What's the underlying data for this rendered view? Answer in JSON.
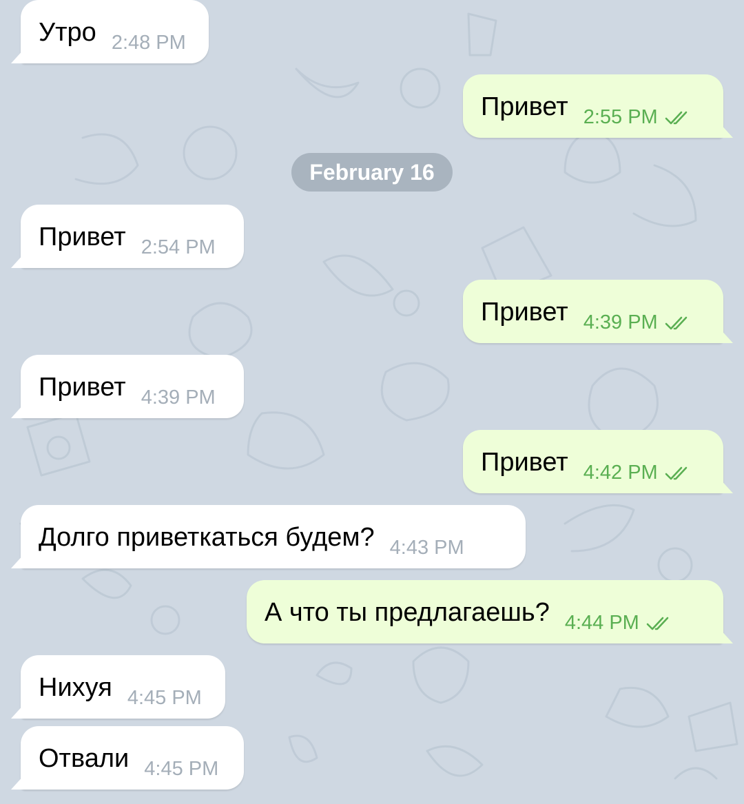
{
  "colors": {
    "background": "#cfd8e2",
    "incoming_bubble": "#ffffff",
    "outgoing_bubble": "#eefed8",
    "outgoing_time": "#5aaf52",
    "incoming_time": "#a4aeb8",
    "date_badge": "#a9b4bf"
  },
  "icons": {
    "read_receipt": "double-check-icon"
  },
  "date_separator": "February 16",
  "messages": [
    {
      "direction": "in",
      "text": "Утро",
      "time": "2:48 PM"
    },
    {
      "direction": "out",
      "text": "Привет",
      "time": "2:55 PM",
      "status": "read"
    },
    {
      "direction": "in",
      "text": "Привет",
      "time": "2:54 PM"
    },
    {
      "direction": "out",
      "text": "Привет",
      "time": "4:39 PM",
      "status": "read"
    },
    {
      "direction": "in",
      "text": "Привет",
      "time": "4:39 PM"
    },
    {
      "direction": "out",
      "text": "Привет",
      "time": "4:42 PM",
      "status": "read"
    },
    {
      "direction": "in",
      "text": "Долго приветкаться будем?",
      "time": "4:43 PM"
    },
    {
      "direction": "out",
      "text": "А что ты предлагаешь?",
      "time": "4:44 PM",
      "status": "read"
    },
    {
      "direction": "in",
      "text": "Нихуя",
      "time": "4:45 PM"
    },
    {
      "direction": "in",
      "text": "Отвали",
      "time": "4:45 PM"
    }
  ]
}
